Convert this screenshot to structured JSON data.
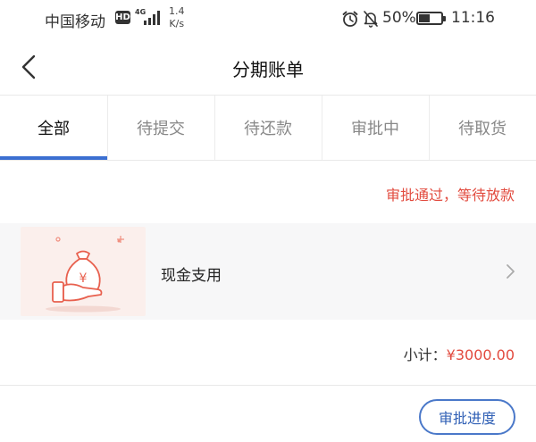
{
  "status_bar": {
    "carrier": "中国移动",
    "network_badge": "HD",
    "network_type": "4G",
    "speed_value": "1.4",
    "speed_unit": "K/s",
    "battery_percent": "50%",
    "battery_level": 0.5,
    "time": "11:16",
    "icons": [
      "signal-icon",
      "alarm-icon",
      "mute-icon",
      "battery-icon"
    ]
  },
  "header": {
    "title": "分期账单",
    "back_icon": "chevron-left-icon"
  },
  "tabs": [
    {
      "label": "全部",
      "active": true
    },
    {
      "label": "待提交",
      "active": false
    },
    {
      "label": "待还款",
      "active": false
    },
    {
      "label": "审批中",
      "active": false
    },
    {
      "label": "待取货",
      "active": false
    }
  ],
  "order": {
    "status": "审批通过，等待放款",
    "item_name": "现金支用",
    "item_image": "money-bag-hand-icon",
    "subtotal_label": "小计：",
    "subtotal_amount": "¥3000.00",
    "action_button": "审批进度"
  },
  "colors": {
    "accent": "#3b6fd1",
    "status_red": "#e24b3f",
    "button_blue": "#2f5fb5"
  }
}
